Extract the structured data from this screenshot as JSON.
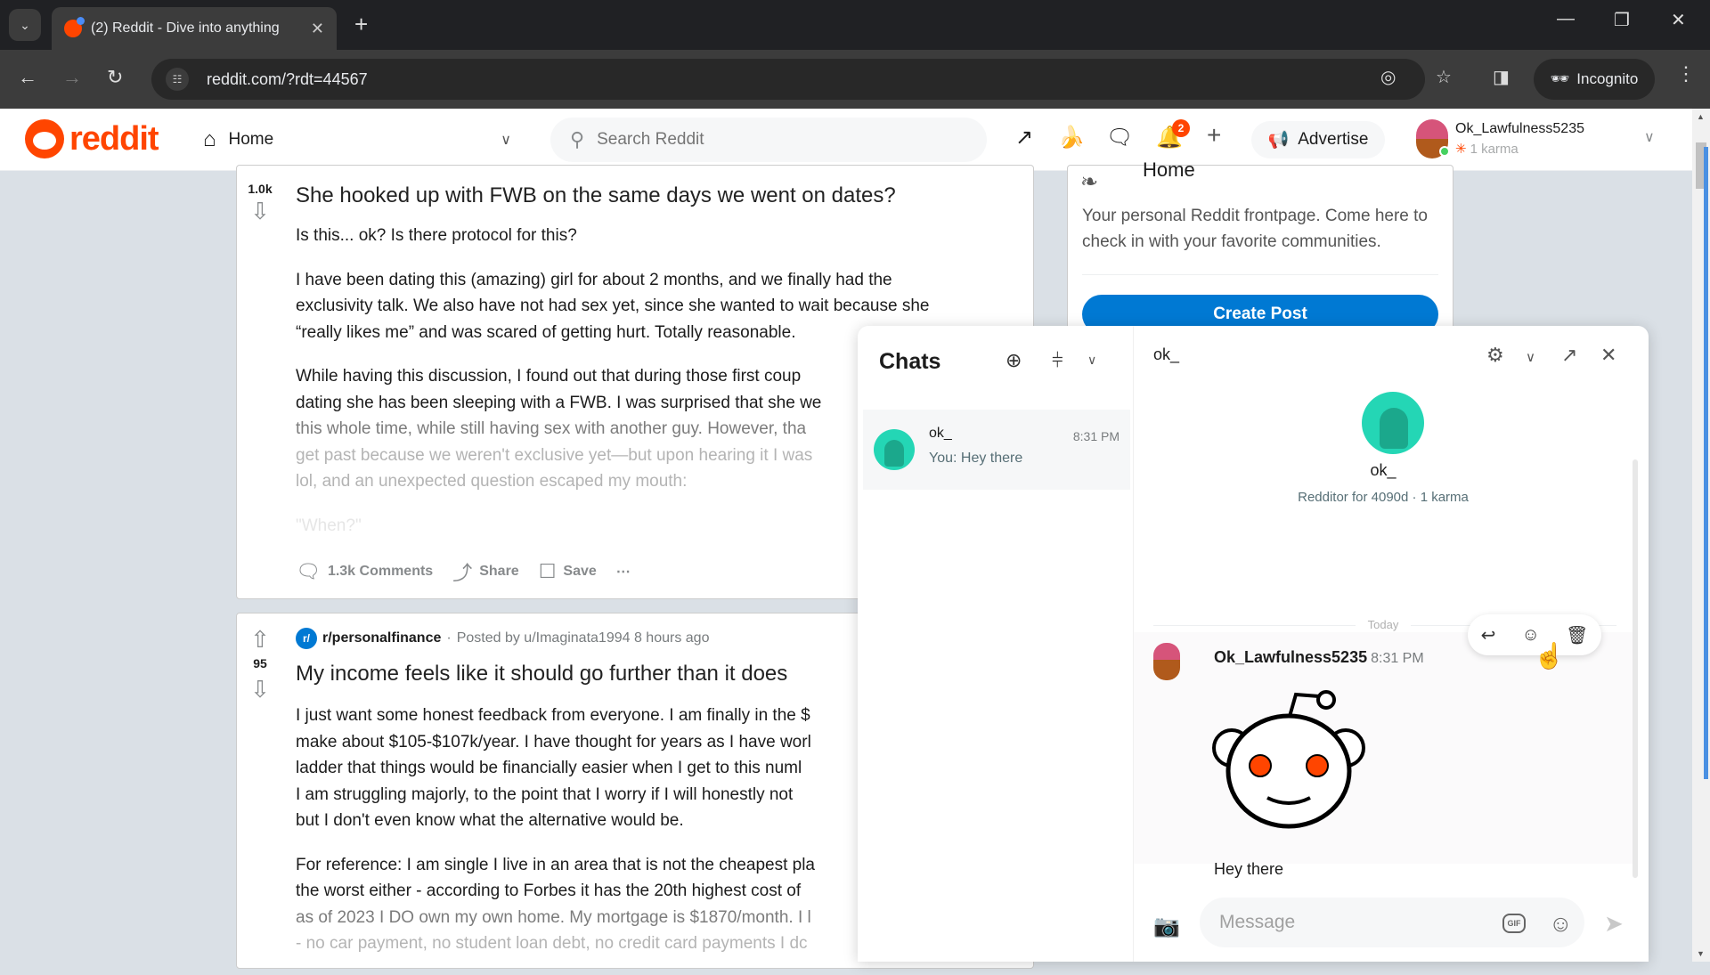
{
  "browser": {
    "tab_title": "(2) Reddit - Dive into anything",
    "url": "reddit.com/?rdt=44567",
    "incognito_label": "Incognito"
  },
  "header": {
    "logo_text": "reddit",
    "feed_label": "Home",
    "search_placeholder": "Search Reddit",
    "notification_count": "2",
    "advertise_label": "Advertise",
    "username": "Ok_Lawfulness5235",
    "karma": "1 karma"
  },
  "posts": [
    {
      "votes": "1.0k",
      "title": "She hooked up with FWB on the same days we went on dates?",
      "body": [
        [
          "Is this... ok? Is there protocol for this?"
        ],
        [
          "I have been dating this (amazing) girl for about 2 months, and we finally had the",
          "exclusivity talk. We also have not had sex yet, since she wanted to wait because she",
          "“really likes me” and was scared of getting hurt. Totally reasonable."
        ],
        [
          "While having this discussion, I found out that during those first coup",
          "dating she has been sleeping with a FWB. I was surprised that she we",
          "this whole time, while still having sex with another guy. However, tha",
          "get past because we weren't exclusive yet—but upon hearing it I was",
          "lol, and an unexpected question escaped my mouth:"
        ],
        [
          "\"When?\""
        ]
      ],
      "comments_label": "1.3k Comments",
      "share_label": "Share",
      "save_label": "Save"
    },
    {
      "subreddit": "r/personalfinance",
      "posted_by": "Posted by u/Imaginata1994 8 hours ago",
      "votes": "95",
      "title": "My income feels like it should go further than it does",
      "body": [
        [
          "I just want some honest feedback from everyone. I am finally in the $",
          "make about $105-$107k/year. I have thought for years as I have worl",
          "ladder that things would be financially easier when I get to this numl",
          "I am struggling majorly, to the point that I worry if I will honestly not",
          "but I don't even know what the alternative would be."
        ],
        [
          "For reference: I am single I live in an area that is not the cheapest pla",
          "the worst either - according to Forbes it has the 20th highest cost of",
          "as of 2023 I DO own my own home. My mortgage is $1870/month. I l",
          "- no car payment, no student loan debt, no credit card payments I dc"
        ]
      ]
    }
  ],
  "sidebar": {
    "title": "Home",
    "description": "Your personal Reddit frontpage. Come here to check in with your favorite communities.",
    "create_post_label": "Create Post"
  },
  "chat": {
    "list_title": "Chats",
    "conversations": [
      {
        "name": "ok_",
        "time": "8:31 PM",
        "preview": "You: Hey there"
      }
    ],
    "active": {
      "title": "ok_",
      "name": "ok_",
      "info": "Redditor for 4090d · 1 karma",
      "date_divider": "Today",
      "message": {
        "author": "Ok_Lawfulness5235",
        "time": "8:31 PM",
        "text": "Hey there"
      },
      "composer_placeholder": "Message",
      "gif_label": "GIF"
    }
  },
  "colors": {
    "brand": "#ff4500",
    "accent": "#0079d3",
    "chat_avatar": "#24d6b5"
  }
}
